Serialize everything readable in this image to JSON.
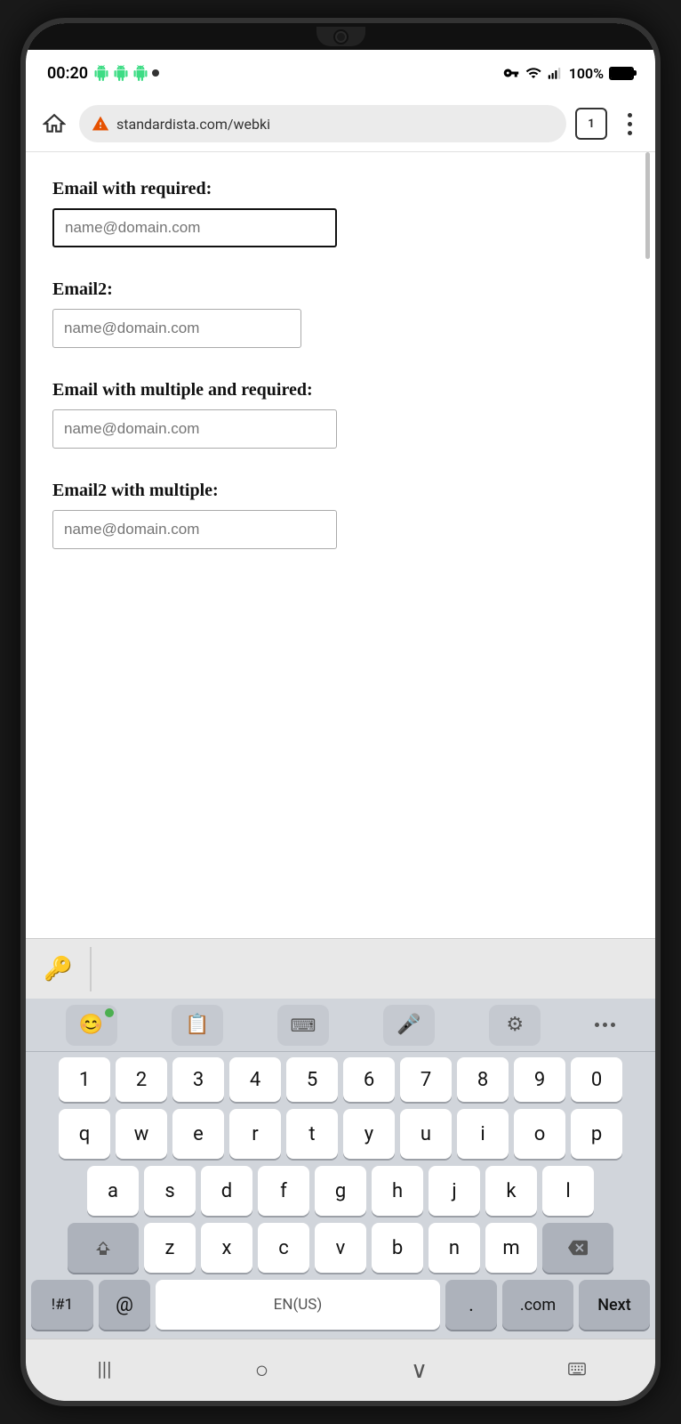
{
  "status_bar": {
    "time": "00:20",
    "battery": "100%",
    "tab_count": "1"
  },
  "browser": {
    "url": "standardista.com/webki",
    "home_label": "home",
    "menu_label": "menu",
    "tabs_label": "tabs"
  },
  "form": {
    "field1": {
      "label": "Email with required:",
      "placeholder": "name@domain.com",
      "border_style": "thick"
    },
    "field2": {
      "label": "Email2:",
      "placeholder": "name@domain.com",
      "border_style": "thin"
    },
    "field3": {
      "label": "Email with multiple and required:",
      "placeholder": "name@domain.com",
      "border_style": "thin"
    },
    "field4": {
      "label": "Email2 with multiple:",
      "placeholder": "name@domain.com",
      "border_style": "thin"
    }
  },
  "keyboard": {
    "toolbar": {
      "emoji_label": "😊",
      "clipboard_label": "📋",
      "keyboard_label": "⌨",
      "mic_label": "🎤",
      "settings_label": "⚙",
      "more_label": "..."
    },
    "rows": {
      "numbers": [
        "1",
        "2",
        "3",
        "4",
        "5",
        "6",
        "7",
        "8",
        "9",
        "0"
      ],
      "row1": [
        "q",
        "w",
        "e",
        "r",
        "t",
        "y",
        "u",
        "i",
        "o",
        "p"
      ],
      "row2": [
        "a",
        "s",
        "d",
        "f",
        "g",
        "h",
        "j",
        "k",
        "l"
      ],
      "row3": [
        "z",
        "x",
        "c",
        "v",
        "b",
        "n",
        "m"
      ],
      "bottom": {
        "sym": "!#1",
        "at": "@",
        "space": "EN(US)",
        "period": ".",
        "dotcom": ".com",
        "next": "Next"
      }
    }
  },
  "bottom_nav": {
    "back": "|||",
    "home": "○",
    "recent": "∨",
    "keyboard": "⊞"
  }
}
